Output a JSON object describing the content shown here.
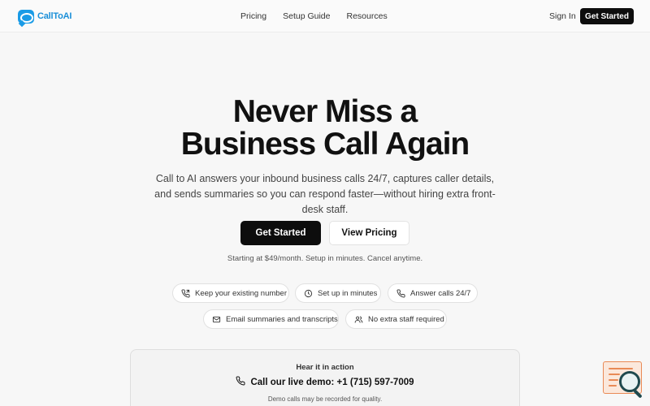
{
  "brand": {
    "name": "CallToAI",
    "color": "#1a8fd8"
  },
  "nav": {
    "items": [
      {
        "label": "Pricing"
      },
      {
        "label": "Setup Guide"
      },
      {
        "label": "Resources"
      }
    ],
    "sign_in": "Sign In",
    "cta": "Get Started"
  },
  "hero": {
    "title_line1": "Never Miss a",
    "title_line2": "Business Call Again",
    "subtitle": "Call to AI answers your inbound business calls 24/7, captures caller details, and sends summaries so you can respond faster—without hiring extra front-desk staff.",
    "primary_button": "Get Started",
    "secondary_button": "View Pricing",
    "price_note": "Starting at $49/month. Setup in minutes. Cancel anytime."
  },
  "features": [
    {
      "icon": "phone-icon",
      "label": "Keep your existing number"
    },
    {
      "icon": "clock-icon",
      "label": "Set up in minutes"
    },
    {
      "icon": "phone-icon",
      "label": "Answer calls 24/7"
    },
    {
      "icon": "mail-icon",
      "label": "Email summaries and transcripts"
    },
    {
      "icon": "users-icon",
      "label": "No extra staff required"
    }
  ],
  "demo": {
    "heading": "Hear it in action",
    "call_text": "Call our live demo: +1 (715) 597-7009",
    "note": "Demo calls may be recorded for quality."
  },
  "widget": {
    "icon": "search-document-icon"
  }
}
